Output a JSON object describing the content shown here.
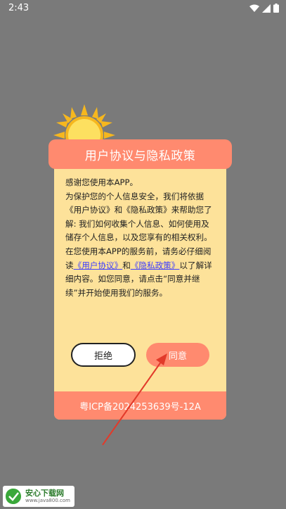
{
  "status_bar": {
    "time": "2:43",
    "icons": [
      "wifi-icon",
      "signal-icon",
      "battery-icon"
    ]
  },
  "dialog": {
    "title": "用户协议与隐私政策",
    "body": {
      "p1": "感谢您使用本APP。",
      "p2": "为保护您的个人信息安全，我们将依据《用户协议》和《隐私政策》来帮助您了解: 我们如何收集个人信息、如何使用及储存个人信息，以及您享有的相关权利。",
      "p3_prefix": "在您使用本APP的服务前，请务必仔细阅读",
      "user_agreement_link": "《用户协议》",
      "p3_and": "和",
      "privacy_policy_link": "《隐私政策》",
      "p3_suffix": "以了解详细内容。如您同意，请点击“同意并继续”并开始使用我们的服务。"
    },
    "reject_label": "拒绝",
    "agree_label": "同意",
    "footer": "粤ICP备2024253639号-12A"
  },
  "watermark": {
    "name": "安心下载网",
    "url": "www.java800.com"
  },
  "colors": {
    "accent": "#ff8a6f",
    "dialog_bg": "#fde29a",
    "backdrop": "#7a7a7a",
    "link": "#3c3cff",
    "arrow": "#e23a2a"
  }
}
